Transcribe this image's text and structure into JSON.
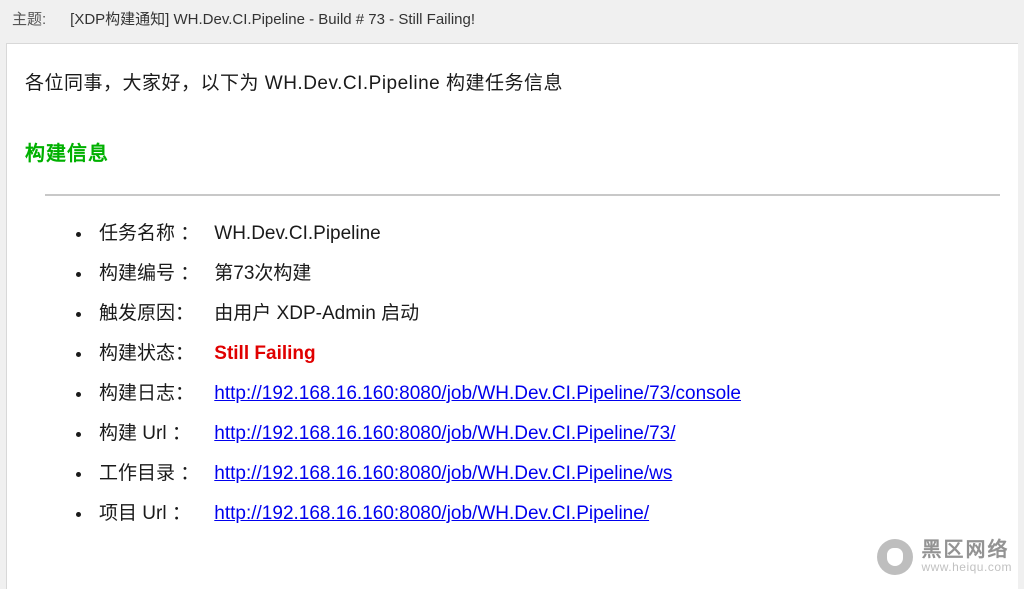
{
  "header": {
    "subject_label": "主题:",
    "subject_value": "[XDP构建通知] WH.Dev.CI.Pipeline - Build # 73 - Still Failing!"
  },
  "body": {
    "greeting": "各位同事，大家好，以下为 WH.Dev.CI.Pipeline 构建任务信息",
    "section_title": "构建信息",
    "items": [
      {
        "label": "任务名称 ：",
        "value": "WH.Dev.CI.Pipeline",
        "type": "text"
      },
      {
        "label": "构建编号 ：",
        "value": "第73次构建",
        "type": "text"
      },
      {
        "label": "触发原因：",
        "value": "由用户 XDP-Admin 启动",
        "type": "text"
      },
      {
        "label": "构建状态：",
        "value": "Still Failing",
        "type": "status"
      },
      {
        "label": "构建日志：",
        "value": "http://192.168.16.160:8080/job/WH.Dev.CI.Pipeline/73/console",
        "type": "link"
      },
      {
        "label": "构建 Url ：",
        "value": "http://192.168.16.160:8080/job/WH.Dev.CI.Pipeline/73/",
        "type": "link"
      },
      {
        "label": "工作目录 ：",
        "value": "http://192.168.16.160:8080/job/WH.Dev.CI.Pipeline/ws",
        "type": "link"
      },
      {
        "label": "项目 Url ：",
        "value": "http://192.168.16.160:8080/job/WH.Dev.CI.Pipeline/",
        "type": "link"
      }
    ]
  },
  "watermark": {
    "cn": "黑区网络",
    "url": "www.heiqu.com"
  }
}
